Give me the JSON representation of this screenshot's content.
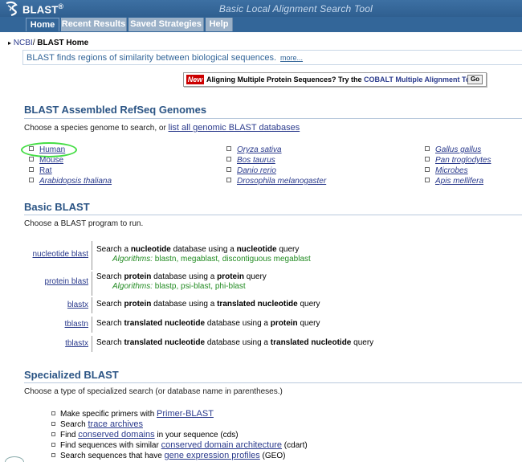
{
  "header": {
    "app_name": "BLAST",
    "registered": "®",
    "tagline": "Basic Local Alignment Search Tool",
    "tabs": [
      {
        "label": "Home",
        "active": true
      },
      {
        "label": "Recent Results",
        "active": false
      },
      {
        "label": "Saved Strategies",
        "active": false
      },
      {
        "label": "Help",
        "active": false
      }
    ]
  },
  "breadcrumb": {
    "arrow": "▸",
    "ncbi": "NCBI",
    "separator": "/",
    "current": " BLAST Home"
  },
  "intro": {
    "text": "BLAST finds regions of similarity between biological sequences.",
    "more": "more..."
  },
  "news": {
    "badge": "New",
    "text": "Aligning Multiple Protein Sequences? Try the ",
    "link": "COBALT Multiple Alignment Tool.",
    "go": "Go"
  },
  "genomes": {
    "title": "BLAST Assembled RefSeq Genomes",
    "prompt": "Choose a species genome to search, or ",
    "prompt_link": "list all genomic BLAST databases",
    "col1": [
      "Human",
      "Mouse",
      "Rat",
      "Arabidopsis thaliana"
    ],
    "col2": [
      "Oryza sativa",
      "Bos taurus",
      "Danio rerio",
      "Drosophila melanogaster"
    ],
    "col3": [
      "Gallus gallus",
      "Pan troglodytes",
      "Microbes",
      "Apis mellifera"
    ]
  },
  "basic": {
    "title": "Basic BLAST",
    "prompt": "Choose a BLAST program to run.",
    "algorithms_label": "Algorithms:",
    "rows": [
      {
        "program": "nucleotide blast",
        "pre": "Search a ",
        "b1": "nucleotide",
        "mid": " database using a ",
        "b2": "nucleotide",
        "post": " query",
        "algos": " blastn, megablast, discontiguous megablast"
      },
      {
        "program": "protein blast",
        "pre": "Search ",
        "b1": "protein",
        "mid": " database using a ",
        "b2": "protein",
        "post": " query",
        "algos": " blastp, psi-blast, phi-blast"
      },
      {
        "program": "blastx",
        "pre": "Search ",
        "b1": "protein",
        "mid": " database using a ",
        "b2": "translated nucleotide",
        "post": " query",
        "algos": ""
      },
      {
        "program": "tblastn",
        "pre": "Search ",
        "b1": "translated nucleotide",
        "mid": " database using a ",
        "b2": "protein",
        "post": " query",
        "algos": ""
      },
      {
        "program": "tblastx",
        "pre": "Search ",
        "b1": "translated nucleotide",
        "mid": " database using a ",
        "b2": "translated nucleotide",
        "post": " query",
        "algos": ""
      }
    ]
  },
  "specialized": {
    "title": "Specialized BLAST",
    "prompt": "Choose a type of specialized search (or database name in parentheses.)",
    "items": [
      {
        "pre": "Make specific primers with ",
        "link": "Primer-BLAST",
        "post": ""
      },
      {
        "pre": "Search ",
        "link": "trace archives",
        "post": ""
      },
      {
        "pre": "Find ",
        "link": "conserved domains",
        "post": " in your sequence (cds)"
      },
      {
        "pre": "Find sequences with similar ",
        "link": "conserved domain architecture",
        "post": " (cdart)"
      },
      {
        "pre": "Search sequences that have ",
        "link": "gene expression profiles",
        "post": " (GEO)"
      }
    ]
  },
  "colors": {
    "header_blue": "#336699",
    "link_blue": "#2a3a8c",
    "heading_blue": "#2c5585",
    "algo_green": "#228b22",
    "highlight_green": "#44dd44",
    "new_red": "#cc0000"
  }
}
